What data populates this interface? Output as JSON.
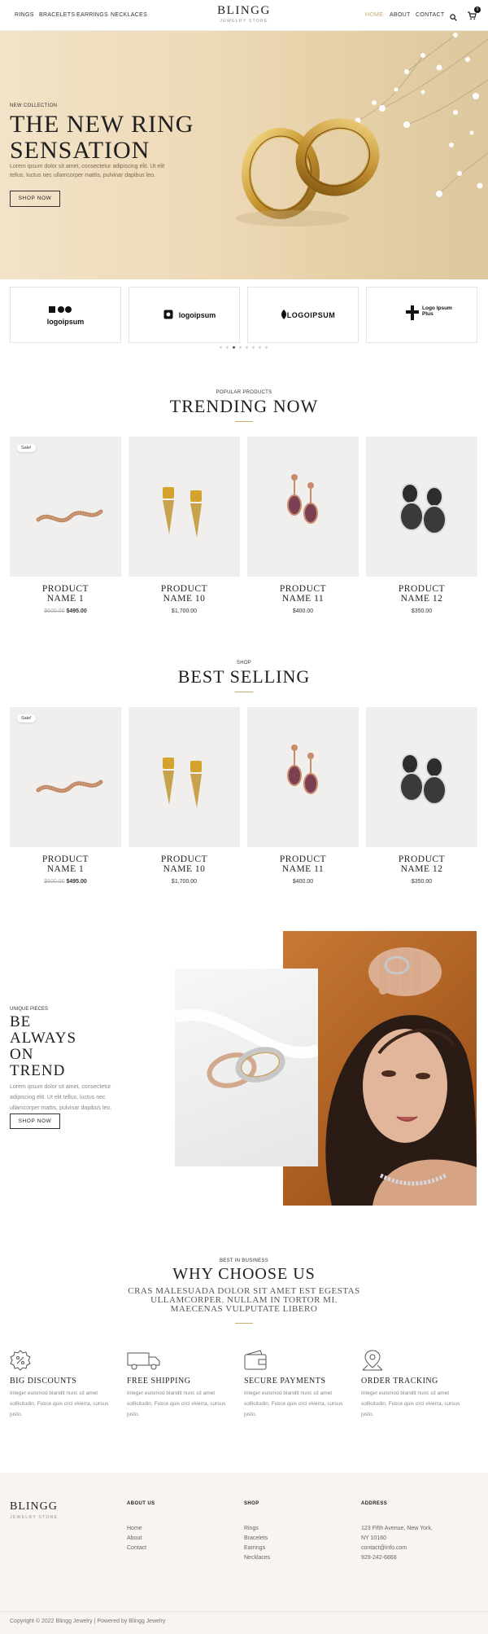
{
  "header": {
    "nav_left": [
      "RINGS",
      "BRACELETS",
      "EARRINGS",
      "NECKLACES"
    ],
    "brand": "BLINGG",
    "brand_sub": "JEWELRY STORE",
    "nav_right": [
      "HOME",
      "ABOUT",
      "CONTACT"
    ],
    "cart_count": "0",
    "active_color": "#c9a96e"
  },
  "hero": {
    "eyebrow": "NEW COLLECTION",
    "title": "THE NEW RING SENSATION",
    "text": "Lorem ipsum dolor sit amet, consectetur adipiscing elit. Ut elit tellus, luctus nec ullamcorper mattis, pulvinar dapibus leo.",
    "button": "SHOP NOW"
  },
  "logos": [
    "logoipsum",
    "logoipsum",
    "LOGOIPSUM",
    "Logo Ipsum Plus"
  ],
  "trending": {
    "eyebrow": "POPULAR PRODUCTS",
    "title": "TRENDING NOW",
    "products": [
      {
        "name_line1": "PRODUCT",
        "name_line2": "NAME 1",
        "old_price": "$600.00",
        "price": "$495.00",
        "badge": "Sale!"
      },
      {
        "name_line1": "PRODUCT",
        "name_line2": "NAME 10",
        "old_price": "",
        "price": "$1,700.00",
        "badge": ""
      },
      {
        "name_line1": "PRODUCT",
        "name_line2": "NAME 11",
        "old_price": "",
        "price": "$400.00",
        "badge": ""
      },
      {
        "name_line1": "PRODUCT",
        "name_line2": "NAME 12",
        "old_price": "",
        "price": "$350.00",
        "badge": ""
      }
    ]
  },
  "best_selling": {
    "eyebrow": "SHOP",
    "title": "BEST SELLING",
    "products": [
      {
        "name_line1": "PRODUCT",
        "name_line2": "NAME 1",
        "old_price": "$600.00",
        "price": "$495.00",
        "badge": "Sale!"
      },
      {
        "name_line1": "PRODUCT",
        "name_line2": "NAME 10",
        "old_price": "",
        "price": "$1,700.00",
        "badge": ""
      },
      {
        "name_line1": "PRODUCT",
        "name_line2": "NAME 11",
        "old_price": "",
        "price": "$400.00",
        "badge": ""
      },
      {
        "name_line1": "PRODUCT",
        "name_line2": "NAME 12",
        "old_price": "",
        "price": "$350.00",
        "badge": ""
      }
    ]
  },
  "trend": {
    "eyebrow": "UNIQUE PIECES",
    "title_lines": [
      "BE",
      "ALWAYS",
      "ON",
      "TREND"
    ],
    "text": "Lorem ipsum dolor sit amet, consectetur adipiscing elit. Ut elit tellus, luctus nec ullamcorper mattis, pulvinar dapibus leo.",
    "button": "SHOP NOW"
  },
  "why": {
    "eyebrow": "BEST IN BUSINESS",
    "title": "WHY CHOOSE US",
    "subtitle": "CRAS MALESUADA DOLOR SIT AMET EST EGESTAS ULLAMCORPER. NULLAM IN TORTOR MI. MAECENAS VULPUTATE LIBERO",
    "features": [
      {
        "icon": "discount-badge-icon",
        "title": "BIG DISCOUNTS",
        "text": "Integer euismod blandit nunc sit amet sollicitudin. Fusce quis orci viverra, cursus justo."
      },
      {
        "icon": "delivery-truck-icon",
        "title": "FREE SHIPPING",
        "text": "Integer euismod blandit nunc sit amet sollicitudin. Fusce quis orci viverra, cursus justo."
      },
      {
        "icon": "wallet-icon",
        "title": "SECURE PAYMENTS",
        "text": "Integer euismod blandit nunc sit amet sollicitudin. Fusce quis orci viverra, cursus justo."
      },
      {
        "icon": "map-pin-icon",
        "title": "ORDER TRACKING",
        "text": "Integer euismod blandit nunc sit amet sollicitudin. Fusce quis orci viverra, cursus justo."
      }
    ]
  },
  "footer": {
    "brand": "BLINGG",
    "brand_sub": "JEWELRY STORE",
    "about_head": "ABOUT US",
    "about_links": [
      "Home",
      "About",
      "Contact"
    ],
    "shop_head": "SHOP",
    "shop_links": [
      "Rings",
      "Bracelets",
      "Earrings",
      "Necklaces"
    ],
    "address_head": "ADDRESS",
    "address_lines": [
      "123 Fifth Avenue, New York,",
      "NY 10160",
      "contact@info.com",
      "929-242-6868"
    ],
    "copyright": "Copyright © 2022 Blingg Jewelry | Powered by Blingg Jewelry"
  }
}
